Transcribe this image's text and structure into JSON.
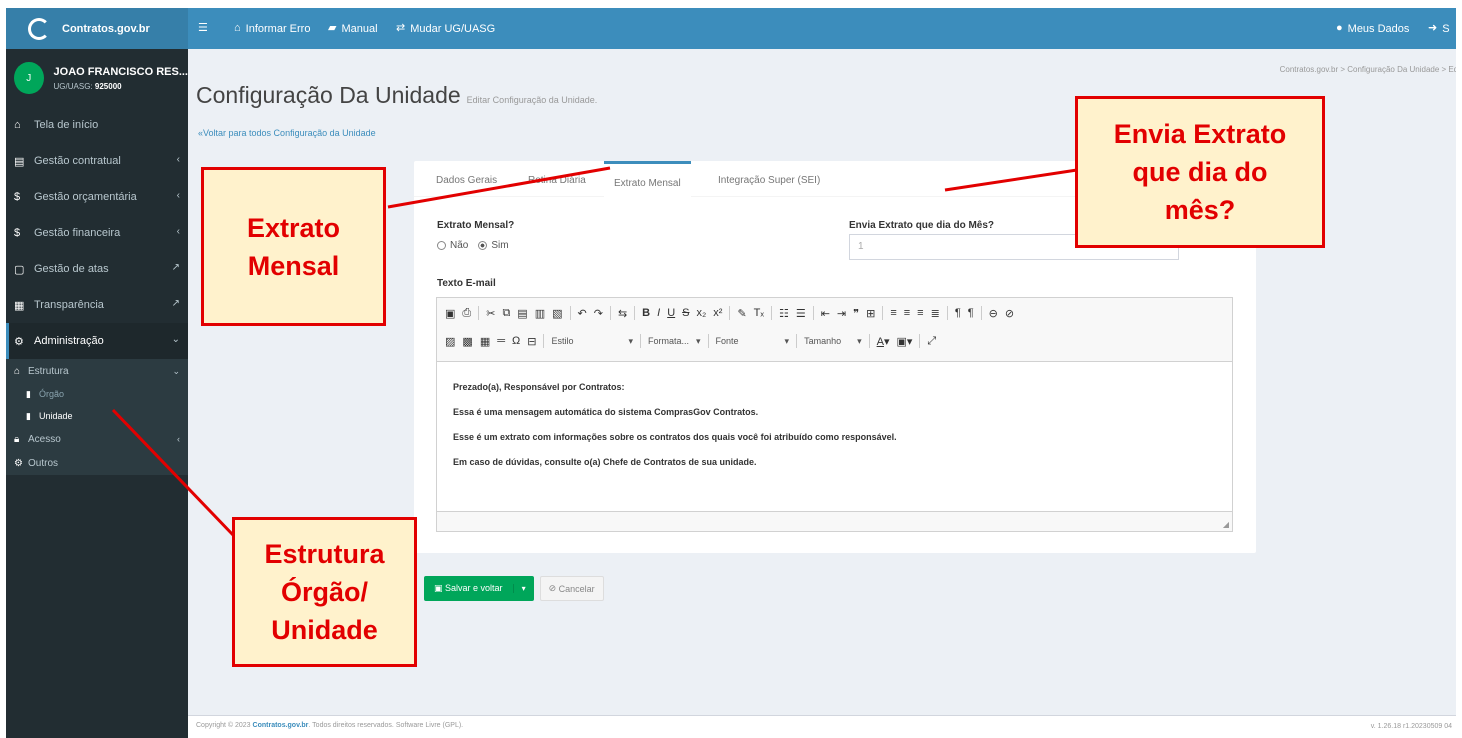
{
  "topbar": {
    "brand": "Contratos.gov.br",
    "nav": [
      "Informar Erro",
      "Manual",
      "Mudar UG/UASG"
    ],
    "meus_dados": "Meus Dados",
    "sair": "S"
  },
  "sidebar": {
    "user_name": "JOAO FRANCISCO RES...",
    "uasg_label": "UG/UASG:",
    "uasg_code": "925000",
    "avatar_initial": "J",
    "items": [
      {
        "label": "Tela de início"
      },
      {
        "label": "Gestão contratual"
      },
      {
        "label": "Gestão orçamentária"
      },
      {
        "label": "Gestão financeira"
      },
      {
        "label": "Gestão de atas"
      },
      {
        "label": "Transparência"
      },
      {
        "label": "Administração"
      }
    ],
    "estrutura": "Estrutura",
    "orgao": "Órgão",
    "unidade": "Unidade",
    "acesso": "Acesso",
    "outros": "Outros"
  },
  "page": {
    "title": "Configuração Da Unidade",
    "subtitle": "Editar Configuração da Unidade.",
    "back_link": "Voltar para todos Configuração da Unidade",
    "breadcrumb": "Contratos.gov.br  >  Configuração Da Unidade  >  Edi"
  },
  "tabs": [
    "Dados Gerais",
    "Rotina Diária",
    "Extrato Mensal",
    "Integração Super (SEI)"
  ],
  "form": {
    "extrato_label": "Extrato Mensal?",
    "opt_nao": "Não",
    "opt_sim": "Sim",
    "selected": "Sim",
    "dia_label": "Envia Extrato que dia do Mês?",
    "dia_value": "1",
    "email_label": "Texto E-mail"
  },
  "editor": {
    "style_dd": "Estilo",
    "format_dd": "Formata...",
    "font_dd": "Fonte",
    "size_dd": "Tamanho",
    "lines": [
      "Prezado(a), Responsável por Contratos:",
      "Essa é uma mensagem automática do sistema ComprasGov Contratos.",
      "Esse é um extrato com informações sobre os contratos dos quais você foi atribuído como responsável.",
      "Em caso de dúvidas, consulte o(a) Chefe de Contratos de sua unidade."
    ]
  },
  "buttons": {
    "save": "Salvar e voltar",
    "cancel": "Cancelar"
  },
  "footer": {
    "prefix": "Copyright © 2023",
    "brand": "Contratos.gov.br",
    "rest": ". Todos direitos reservados. Software Livre (GPL).",
    "version": "v. 1.26.18 r1.20230509 04"
  },
  "callouts": {
    "extrato": "Extrato Mensal",
    "envia": "Envia Extrato que dia do mês?",
    "estrutura": "Estrutura Órgão/ Unidade"
  },
  "colors": {
    "topbar": "#3c8dbc",
    "sidebar": "#222d32",
    "callout_border": "#e20000",
    "callout_fill": "#fff2cc",
    "save": "#00a65a"
  }
}
